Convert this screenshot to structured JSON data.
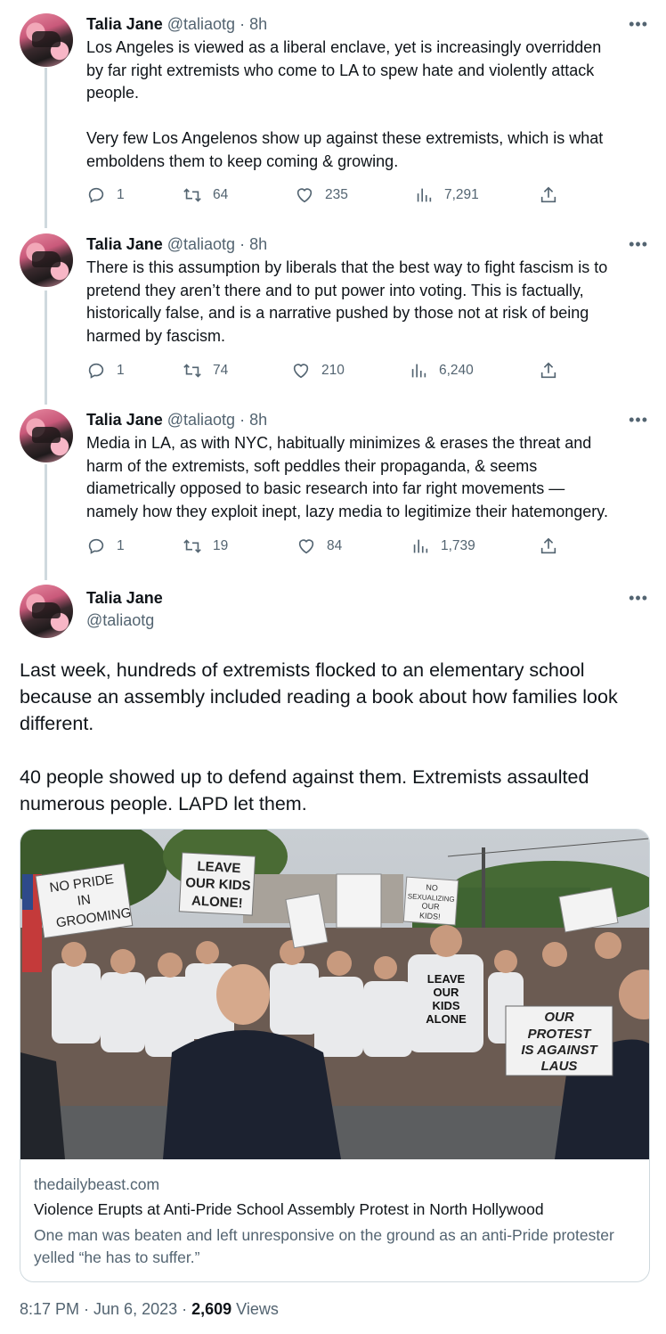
{
  "author": {
    "name": "Talia Jane",
    "handle": "@taliaotg",
    "time": "8h"
  },
  "more_glyph": "•••",
  "tweets": [
    {
      "text": "Los Angeles is viewed as a liberal enclave, yet is increasingly overridden\nby far right extremists who come to LA to spew hate and violently attack\npeople.\n\nVery few Los Angelenos show up against these extremists, which is what\nemboldens them to keep coming & growing.",
      "replies": "1",
      "retweets": "64",
      "likes": "235",
      "views": "7,291"
    },
    {
      "text": "There is this assumption by liberals that the best way to fight fascism is to\npretend they aren’t there and to put power into voting. This is factually,\nhistorically false, and is a narrative pushed by those not at risk of being\nharmed by fascism.",
      "replies": "1",
      "retweets": "74",
      "likes": "210",
      "views": "6,240"
    },
    {
      "text": "Media in LA, as with NYC, habitually minimizes & erases the threat and\nharm of the extremists, soft peddles their propaganda, & seems\ndiametrically opposed to basic research into far right movements —\nnamely how they exploit inept, lazy media to legitimize their hatemongery.",
      "replies": "1",
      "retweets": "19",
      "likes": "84",
      "views": "1,739"
    }
  ],
  "main_tweet": {
    "text": "Last week, hundreds of extremists flocked to an elementary school\nbecause an assembly included reading a book about how families look\ndifferent.\n\n40 people showed up to defend against them. Extremists assaulted\nnumerous people. LAPD let them.",
    "card": {
      "domain": "thedailybeast.com",
      "title": "Violence Erupts at Anti-Pride School Assembly Protest in North Hollywood",
      "description": "One man was beaten and left unresponsive on the ground as an anti-Pride protester yelled “he has to suffer.”",
      "signs": {
        "no_pride": [
          "NO PRIDE",
          "IN",
          "GROOMING"
        ],
        "leave_kids": [
          "LEAVE",
          "OUR KIDS",
          "ALONE!"
        ],
        "no_sexualizing": [
          "NO",
          "SEXUALIZING",
          "OUR",
          "KIDS!"
        ],
        "our_protest": [
          "OUR",
          "PROTEST",
          "IS AGAINST",
          "LAUS"
        ],
        "shirt": [
          "LEAVE",
          "OUR",
          "KIDS",
          "ALONE"
        ]
      }
    },
    "timestamp": "8:17 PM · Jun 6, 2023 · ",
    "views_count": "2,609",
    "views_label": " Views"
  },
  "colors": {
    "text": "#0f1419",
    "secondary": "#536471",
    "border": "#cfd9de",
    "thread_line": "#cfd9de"
  },
  "icons": [
    "reply-icon",
    "retweet-icon",
    "like-icon",
    "views-icon",
    "share-icon",
    "more-icon"
  ]
}
